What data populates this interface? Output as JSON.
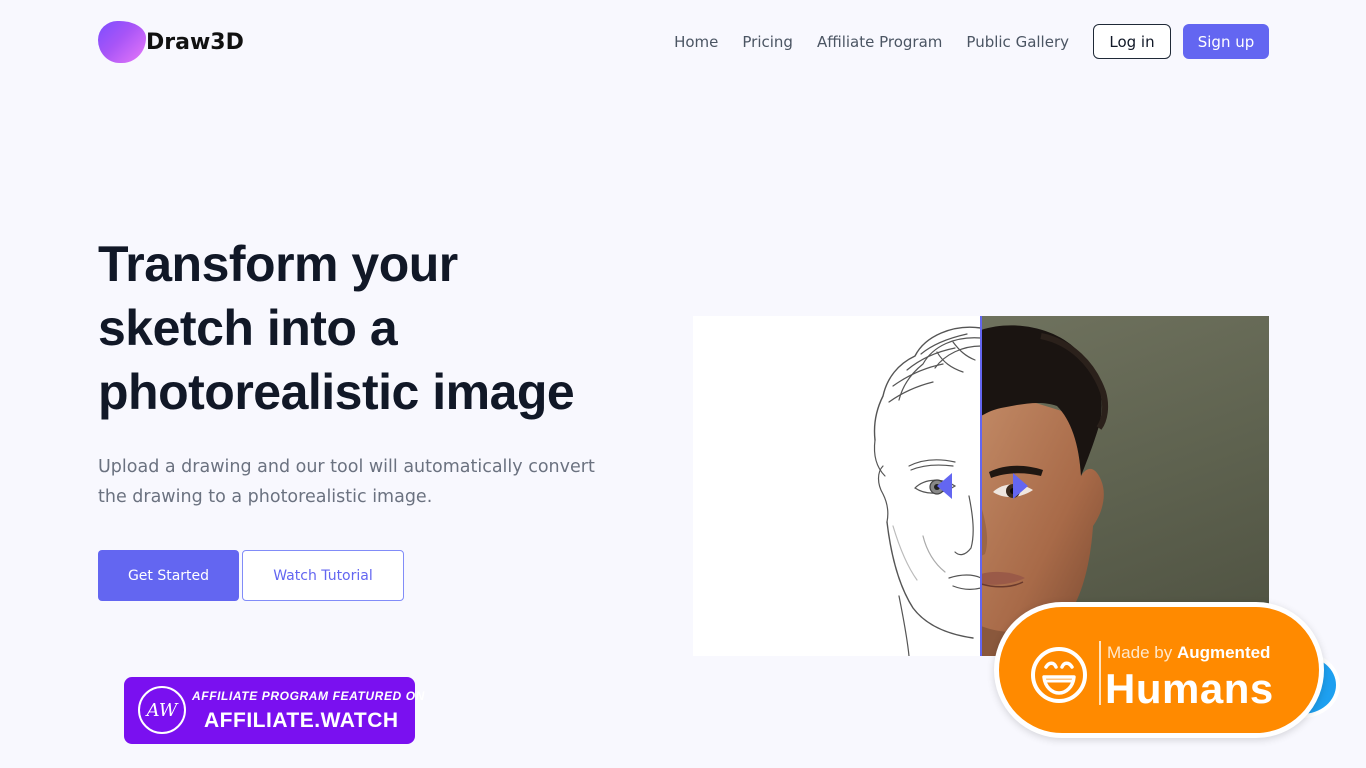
{
  "header": {
    "brand": "Draw3D",
    "nav": [
      {
        "label": "Home"
      },
      {
        "label": "Pricing"
      },
      {
        "label": "Affiliate Program"
      },
      {
        "label": "Public Gallery"
      }
    ],
    "login_label": "Log in",
    "signup_label": "Sign up"
  },
  "hero": {
    "title_lines": [
      "Transform your",
      "sketch into a",
      "photorealistic image"
    ],
    "subtitle": "Upload a drawing and our tool will automatically convert the drawing to a photorealistic image.",
    "primary_cta": "Get Started",
    "secondary_cta": "Watch Tutorial"
  },
  "affiliate_badge": {
    "monogram": "AW",
    "top_text": "AFFILIATE PROGRAM FEATURED ON",
    "main_text": "AFFILIATE.WATCH"
  },
  "made_by_badge": {
    "prefix": "Made by",
    "brand": "Augmented",
    "main": "Humans"
  },
  "colors": {
    "accent": "#6366f1",
    "badge_purple": "#7a10f0",
    "badge_orange": "#ff8a00",
    "background": "#f8f8fe"
  },
  "icons": {
    "logo": "blob-logo-icon",
    "slider_left": "arrow-left-icon",
    "slider_right": "arrow-right-icon",
    "smiley": "smiley-face-icon"
  }
}
